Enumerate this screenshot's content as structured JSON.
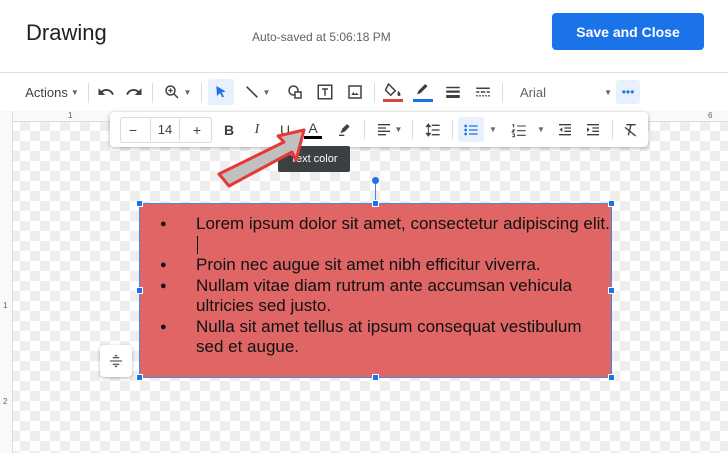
{
  "header": {
    "title": "Drawing",
    "autosave": "Auto-saved at 5:06:18 PM",
    "save_label": "Save and Close"
  },
  "toolbar": {
    "actions_label": "Actions",
    "font": "Arial",
    "more": "•••"
  },
  "rulers": {
    "top_numbers": [
      "1",
      "6"
    ],
    "left_numbers": [
      "1",
      "2"
    ]
  },
  "format_bar": {
    "font_size": "14",
    "minus": "−",
    "plus": "+",
    "bold": "B",
    "italic": "I",
    "underline": "U",
    "text_color": "A"
  },
  "tooltip": "Text color",
  "textbox": {
    "fill_color": "#e06666",
    "border_color": "#4285f4",
    "bullets": [
      "Lorem ipsum dolor sit amet, consectetur adipiscing elit.",
      "Proin nec augue sit amet nibh efficitur viverra.",
      "Nullam vitae diam rutrum ante accumsan vehicula ultricies sed justo.",
      "Nulla sit amet tellus at ipsum consequat vestibulum sed et augue."
    ]
  },
  "colors": {
    "accent": "#1a73e8",
    "fill_underline": "#db4437",
    "pen_underline": "#1a73e8"
  }
}
